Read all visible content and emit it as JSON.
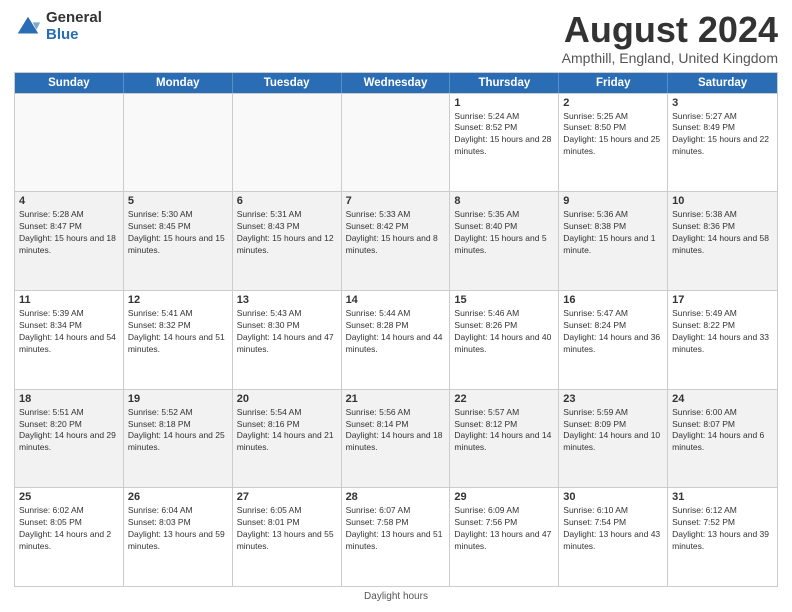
{
  "logo": {
    "general": "General",
    "blue": "Blue"
  },
  "title": {
    "month_year": "August 2024",
    "location": "Ampthill, England, United Kingdom"
  },
  "weekdays": [
    "Sunday",
    "Monday",
    "Tuesday",
    "Wednesday",
    "Thursday",
    "Friday",
    "Saturday"
  ],
  "weeks": [
    [
      {
        "day": "",
        "sunrise": "",
        "sunset": "",
        "daylight": "",
        "empty": true
      },
      {
        "day": "",
        "sunrise": "",
        "sunset": "",
        "daylight": "",
        "empty": true
      },
      {
        "day": "",
        "sunrise": "",
        "sunset": "",
        "daylight": "",
        "empty": true
      },
      {
        "day": "",
        "sunrise": "",
        "sunset": "",
        "daylight": "",
        "empty": true
      },
      {
        "day": "1",
        "sunrise": "Sunrise: 5:24 AM",
        "sunset": "Sunset: 8:52 PM",
        "daylight": "Daylight: 15 hours and 28 minutes.",
        "empty": false
      },
      {
        "day": "2",
        "sunrise": "Sunrise: 5:25 AM",
        "sunset": "Sunset: 8:50 PM",
        "daylight": "Daylight: 15 hours and 25 minutes.",
        "empty": false
      },
      {
        "day": "3",
        "sunrise": "Sunrise: 5:27 AM",
        "sunset": "Sunset: 8:49 PM",
        "daylight": "Daylight: 15 hours and 22 minutes.",
        "empty": false
      }
    ],
    [
      {
        "day": "4",
        "sunrise": "Sunrise: 5:28 AM",
        "sunset": "Sunset: 8:47 PM",
        "daylight": "Daylight: 15 hours and 18 minutes.",
        "empty": false
      },
      {
        "day": "5",
        "sunrise": "Sunrise: 5:30 AM",
        "sunset": "Sunset: 8:45 PM",
        "daylight": "Daylight: 15 hours and 15 minutes.",
        "empty": false
      },
      {
        "day": "6",
        "sunrise": "Sunrise: 5:31 AM",
        "sunset": "Sunset: 8:43 PM",
        "daylight": "Daylight: 15 hours and 12 minutes.",
        "empty": false
      },
      {
        "day": "7",
        "sunrise": "Sunrise: 5:33 AM",
        "sunset": "Sunset: 8:42 PM",
        "daylight": "Daylight: 15 hours and 8 minutes.",
        "empty": false
      },
      {
        "day": "8",
        "sunrise": "Sunrise: 5:35 AM",
        "sunset": "Sunset: 8:40 PM",
        "daylight": "Daylight: 15 hours and 5 minutes.",
        "empty": false
      },
      {
        "day": "9",
        "sunrise": "Sunrise: 5:36 AM",
        "sunset": "Sunset: 8:38 PM",
        "daylight": "Daylight: 15 hours and 1 minute.",
        "empty": false
      },
      {
        "day": "10",
        "sunrise": "Sunrise: 5:38 AM",
        "sunset": "Sunset: 8:36 PM",
        "daylight": "Daylight: 14 hours and 58 minutes.",
        "empty": false
      }
    ],
    [
      {
        "day": "11",
        "sunrise": "Sunrise: 5:39 AM",
        "sunset": "Sunset: 8:34 PM",
        "daylight": "Daylight: 14 hours and 54 minutes.",
        "empty": false
      },
      {
        "day": "12",
        "sunrise": "Sunrise: 5:41 AM",
        "sunset": "Sunset: 8:32 PM",
        "daylight": "Daylight: 14 hours and 51 minutes.",
        "empty": false
      },
      {
        "day": "13",
        "sunrise": "Sunrise: 5:43 AM",
        "sunset": "Sunset: 8:30 PM",
        "daylight": "Daylight: 14 hours and 47 minutes.",
        "empty": false
      },
      {
        "day": "14",
        "sunrise": "Sunrise: 5:44 AM",
        "sunset": "Sunset: 8:28 PM",
        "daylight": "Daylight: 14 hours and 44 minutes.",
        "empty": false
      },
      {
        "day": "15",
        "sunrise": "Sunrise: 5:46 AM",
        "sunset": "Sunset: 8:26 PM",
        "daylight": "Daylight: 14 hours and 40 minutes.",
        "empty": false
      },
      {
        "day": "16",
        "sunrise": "Sunrise: 5:47 AM",
        "sunset": "Sunset: 8:24 PM",
        "daylight": "Daylight: 14 hours and 36 minutes.",
        "empty": false
      },
      {
        "day": "17",
        "sunrise": "Sunrise: 5:49 AM",
        "sunset": "Sunset: 8:22 PM",
        "daylight": "Daylight: 14 hours and 33 minutes.",
        "empty": false
      }
    ],
    [
      {
        "day": "18",
        "sunrise": "Sunrise: 5:51 AM",
        "sunset": "Sunset: 8:20 PM",
        "daylight": "Daylight: 14 hours and 29 minutes.",
        "empty": false
      },
      {
        "day": "19",
        "sunrise": "Sunrise: 5:52 AM",
        "sunset": "Sunset: 8:18 PM",
        "daylight": "Daylight: 14 hours and 25 minutes.",
        "empty": false
      },
      {
        "day": "20",
        "sunrise": "Sunrise: 5:54 AM",
        "sunset": "Sunset: 8:16 PM",
        "daylight": "Daylight: 14 hours and 21 minutes.",
        "empty": false
      },
      {
        "day": "21",
        "sunrise": "Sunrise: 5:56 AM",
        "sunset": "Sunset: 8:14 PM",
        "daylight": "Daylight: 14 hours and 18 minutes.",
        "empty": false
      },
      {
        "day": "22",
        "sunrise": "Sunrise: 5:57 AM",
        "sunset": "Sunset: 8:12 PM",
        "daylight": "Daylight: 14 hours and 14 minutes.",
        "empty": false
      },
      {
        "day": "23",
        "sunrise": "Sunrise: 5:59 AM",
        "sunset": "Sunset: 8:09 PM",
        "daylight": "Daylight: 14 hours and 10 minutes.",
        "empty": false
      },
      {
        "day": "24",
        "sunrise": "Sunrise: 6:00 AM",
        "sunset": "Sunset: 8:07 PM",
        "daylight": "Daylight: 14 hours and 6 minutes.",
        "empty": false
      }
    ],
    [
      {
        "day": "25",
        "sunrise": "Sunrise: 6:02 AM",
        "sunset": "Sunset: 8:05 PM",
        "daylight": "Daylight: 14 hours and 2 minutes.",
        "empty": false
      },
      {
        "day": "26",
        "sunrise": "Sunrise: 6:04 AM",
        "sunset": "Sunset: 8:03 PM",
        "daylight": "Daylight: 13 hours and 59 minutes.",
        "empty": false
      },
      {
        "day": "27",
        "sunrise": "Sunrise: 6:05 AM",
        "sunset": "Sunset: 8:01 PM",
        "daylight": "Daylight: 13 hours and 55 minutes.",
        "empty": false
      },
      {
        "day": "28",
        "sunrise": "Sunrise: 6:07 AM",
        "sunset": "Sunset: 7:58 PM",
        "daylight": "Daylight: 13 hours and 51 minutes.",
        "empty": false
      },
      {
        "day": "29",
        "sunrise": "Sunrise: 6:09 AM",
        "sunset": "Sunset: 7:56 PM",
        "daylight": "Daylight: 13 hours and 47 minutes.",
        "empty": false
      },
      {
        "day": "30",
        "sunrise": "Sunrise: 6:10 AM",
        "sunset": "Sunset: 7:54 PM",
        "daylight": "Daylight: 13 hours and 43 minutes.",
        "empty": false
      },
      {
        "day": "31",
        "sunrise": "Sunrise: 6:12 AM",
        "sunset": "Sunset: 7:52 PM",
        "daylight": "Daylight: 13 hours and 39 minutes.",
        "empty": false
      }
    ]
  ],
  "footer": {
    "note": "Daylight hours"
  }
}
